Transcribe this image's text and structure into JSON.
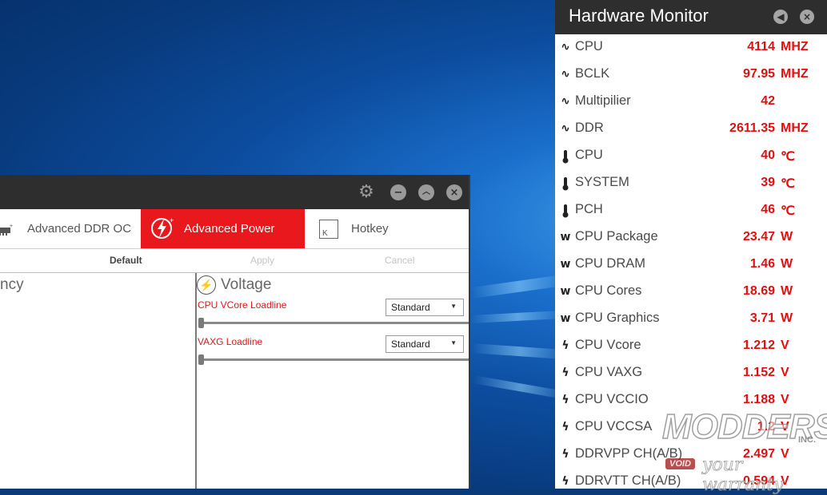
{
  "app": {
    "tabs": [
      {
        "label": "Advanced DDR OC"
      },
      {
        "label": "Advanced Power"
      },
      {
        "label": "Hotkey"
      }
    ],
    "hotkey_icon_letter": "K",
    "actions": {
      "default": "Default",
      "apply": "Apply",
      "cancel": "Cancel"
    },
    "left_heading": "ncy",
    "voltage": {
      "heading": "Voltage",
      "settings": [
        {
          "label": "CPU VCore Loadline",
          "value": "Standard",
          "slider_level": 0
        },
        {
          "label": "VAXG Loadline",
          "value": "Standard",
          "slider_level": 0
        }
      ]
    },
    "accent_color": "#e8181d"
  },
  "hardware_monitor": {
    "title": "Hardware Monitor",
    "rows": [
      {
        "icon": "waveform-icon",
        "name": "CPU",
        "value": "4114",
        "unit": "MHZ"
      },
      {
        "icon": "waveform-icon",
        "name": "BCLK",
        "value": "97.95",
        "unit": "MHZ"
      },
      {
        "icon": "waveform-icon",
        "name": "Multipilier",
        "value": "42",
        "unit": ""
      },
      {
        "icon": "waveform-icon",
        "name": "DDR",
        "value": "2611.35",
        "unit": "MHZ"
      },
      {
        "icon": "thermometer-icon",
        "name": "CPU",
        "value": "40",
        "unit": "℃"
      },
      {
        "icon": "thermometer-icon",
        "name": "SYSTEM",
        "value": "39",
        "unit": "℃"
      },
      {
        "icon": "thermometer-icon",
        "name": "PCH",
        "value": "46",
        "unit": "℃"
      },
      {
        "icon": "watt-icon",
        "name": "CPU Package",
        "value": "23.47",
        "unit": "W"
      },
      {
        "icon": "watt-icon",
        "name": "CPU DRAM",
        "value": "1.46",
        "unit": "W"
      },
      {
        "icon": "watt-icon",
        "name": "CPU Cores",
        "value": "18.69",
        "unit": "W"
      },
      {
        "icon": "watt-icon",
        "name": "CPU Graphics",
        "value": "3.71",
        "unit": "W"
      },
      {
        "icon": "bolt-icon",
        "name": "CPU Vcore",
        "value": "1.212",
        "unit": "V"
      },
      {
        "icon": "bolt-icon",
        "name": "CPU VAXG",
        "value": "1.152",
        "unit": "V"
      },
      {
        "icon": "bolt-icon",
        "name": "CPU VCCIO",
        "value": "1.188",
        "unit": "V"
      },
      {
        "icon": "bolt-icon",
        "name": "CPU VCCSA",
        "value": "1.2",
        "unit": "V"
      },
      {
        "icon": "bolt-icon",
        "name": "DDRVPP CH(A/B)",
        "value": "2.497",
        "unit": "V"
      },
      {
        "icon": "bolt-icon",
        "name": "DDRVTT CH(A/B)",
        "value": "0.594",
        "unit": "V"
      }
    ],
    "value_color": "#e01010"
  },
  "watermark": {
    "main": "MODDERS",
    "inc": "INC.",
    "void": "VOID",
    "tagline": "your warranty"
  }
}
